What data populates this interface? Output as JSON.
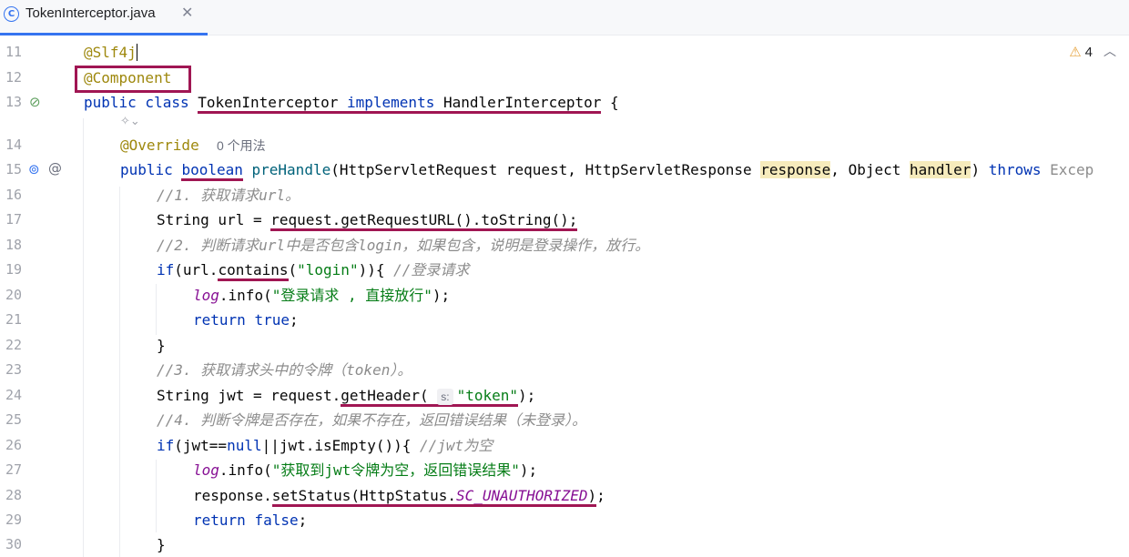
{
  "tab": {
    "title": "TokenInterceptor.java",
    "icon": "class-icon",
    "icon_glyph": "C",
    "close": "✕"
  },
  "editor": {
    "warnings_count": "4",
    "line_numbers": [
      "11",
      "12",
      "13",
      "14",
      "15",
      "16",
      "17",
      "18",
      "19",
      "20",
      "21",
      "22",
      "23",
      "24",
      "25",
      "26",
      "27",
      "28",
      "29",
      "30"
    ],
    "usage_hint": "0 个用法",
    "param_hint": "s:",
    "lines": {
      "l11_ann": "@Slf4j",
      "l12_ann": "@Component",
      "l13_kw1": "public class ",
      "l13_name": "TokenInterceptor",
      "l13_impl": "implements",
      "l13_iface": "HandlerInterceptor",
      "l13_brace": " {",
      "l14_ann": "@Override",
      "l15_kw": "public ",
      "l15_bool": "boolean",
      "l15_fn": "preHandle",
      "l15_params1": "(HttpServletRequest request, HttpServletResponse ",
      "l15_resp": "response",
      "l15_params2": ", Object ",
      "l15_handler": "handler",
      "l15_close": ") ",
      "l15_throws": "throws",
      "l15_exc": " Excep",
      "l16": "//1. 获取请求url。",
      "l17_a": "String url = ",
      "l17_b": "request.getRequestURL().toString();",
      "l18": "//2. 判断请求url中是否包含login，如果包含，说明是登录操作，放行。",
      "l19_kw": "if",
      "l19_a": "(url.",
      "l19_fn": "contains",
      "l19_b": "(",
      "l19_str": "\"login\"",
      "l19_c": ")){ ",
      "l19_cmt": "//登录请求",
      "l20_log": "log",
      "l20_a": ".info(",
      "l20_str": "\"登录请求 , 直接放行\"",
      "l20_b": ");",
      "l21_kw": "return ",
      "l21_val": "true",
      "l21_end": ";",
      "l22": "}",
      "l23": "//3. 获取请求头中的令牌（token）。",
      "l24_a": "String jwt = request.",
      "l24_fn": "getHeader(",
      "l24_str": "\"token\"",
      "l24_b": ");",
      "l25": "//4. 判断令牌是否存在，如果不存在，返回错误结果（未登录）。",
      "l26_kw": "if",
      "l26_a": "(jwt==",
      "l26_null": "null",
      "l26_b": "||jwt.isEmpty()){ ",
      "l26_cmt": "//jwt为空",
      "l27_log": "log",
      "l27_a": ".info(",
      "l27_str": "\"获取到jwt令牌为空，返回错误结果\"",
      "l27_b": ");",
      "l28_a": "response.",
      "l28_b": "setStatus(HttpStatus.",
      "l28_const": "SC_UNAUTHORIZED",
      "l28_c": ")",
      "l28_d": ";",
      "l29_kw": "return ",
      "l29_val": "false",
      "l29_end": ";",
      "l30": "}"
    }
  },
  "colors": {
    "accent": "#3574f0",
    "highlight_markup": "#a01653",
    "keyword": "#0033b3",
    "string": "#067d17",
    "comment": "#8c8c8c"
  }
}
